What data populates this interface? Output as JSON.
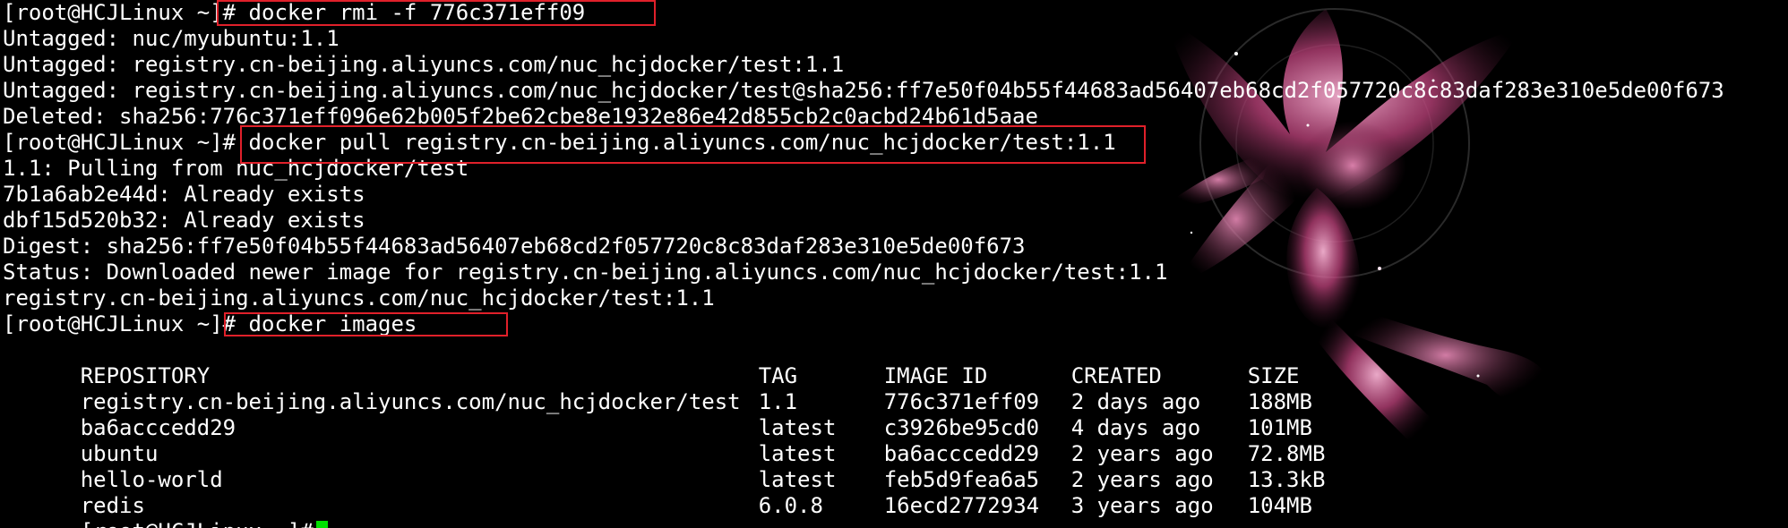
{
  "terminal": {
    "lines": [
      {
        "prompt": "[root@HCJLinux ~]#",
        "text": " docker rmi -f 776c371eff09"
      },
      {
        "text": "Untagged: nuc/myubuntu:1.1"
      },
      {
        "text": "Untagged: registry.cn-beijing.aliyuncs.com/nuc_hcjdocker/test:1.1"
      },
      {
        "text": "Untagged: registry.cn-beijing.aliyuncs.com/nuc_hcjdocker/test@sha256:ff7e50f04b55f44683ad56407eb68cd2f057720c8c83daf283e310e5de00f673"
      },
      {
        "text": "Deleted: sha256:776c371eff096e62b005f2be62cbe8e1932e86e42d855cb2c0acbd24b61d5aae"
      },
      {
        "prompt": "[root@HCJLinux ~]#",
        "text": " docker pull registry.cn-beijing.aliyuncs.com/nuc_hcjdocker/test:1.1"
      },
      {
        "text": "1.1: Pulling from nuc_hcjdocker/test"
      },
      {
        "text": "7b1a6ab2e44d: Already exists"
      },
      {
        "text": "dbf15d520b32: Already exists"
      },
      {
        "text": "Digest: sha256:ff7e50f04b55f44683ad56407eb68cd2f057720c8c83daf283e310e5de00f673"
      },
      {
        "text": "Status: Downloaded newer image for registry.cn-beijing.aliyuncs.com/nuc_hcjdocker/test:1.1"
      },
      {
        "text": "registry.cn-beijing.aliyuncs.com/nuc_hcjdocker/test:1.1"
      },
      {
        "prompt": "[root@HCJLinux ~]#",
        "text": " docker images"
      }
    ],
    "images_table": {
      "headers": [
        "REPOSITORY",
        "TAG",
        "IMAGE ID",
        "CREATED",
        "SIZE"
      ],
      "rows": [
        [
          "registry.cn-beijing.aliyuncs.com/nuc_hcjdocker/test",
          "1.1",
          "776c371eff09",
          "2 days ago",
          "188MB"
        ],
        [
          "ba6acccedd29",
          "latest",
          "c3926be95cd0",
          "4 days ago",
          "101MB"
        ],
        [
          "ubuntu",
          "latest",
          "ba6acccedd29",
          "2 years ago",
          "72.8MB"
        ],
        [
          "hello-world",
          "latest",
          "feb5d9fea6a5",
          "2 years ago",
          "13.3kB"
        ],
        [
          "redis",
          "6.0.8",
          "16ecd2772934",
          "3 years ago",
          "104MB"
        ]
      ]
    },
    "final_prompt": "[root@HCJLinux ~]#",
    "colors": {
      "background": "#000000",
      "text": "#ffffff",
      "highlight_box": "#e0202a",
      "cursor": "#00e000",
      "art_pink": "#e86fa8"
    }
  }
}
